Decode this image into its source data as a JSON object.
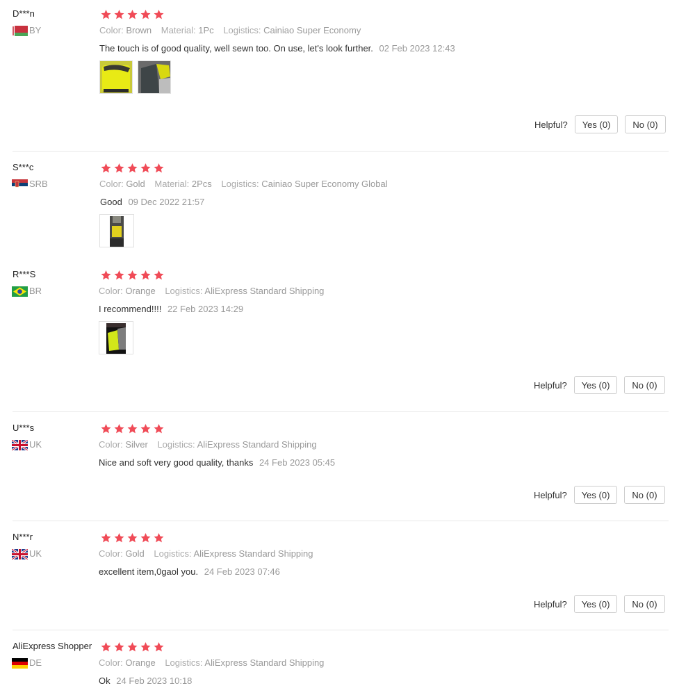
{
  "helpful_label": "Helpful?",
  "yes_label": "Yes (0)",
  "no_label": "No (0)",
  "star_color": "#f04b57",
  "reviews": [
    {
      "user": "D***n",
      "country": "BY",
      "rating": 5,
      "attributes": [
        {
          "key": "Color:",
          "value": "Brown"
        },
        {
          "key": "Material:",
          "value": "1Pc"
        },
        {
          "key": "Logistics:",
          "value": "Cainiao Super Economy"
        }
      ],
      "text": "The touch is of good quality, well sewn too. On use, let's look further.",
      "date": "02 Feb 2023 12:43",
      "photos": 2
    },
    {
      "user": "S***c",
      "country": "SRB",
      "rating": 5,
      "attributes": [
        {
          "key": "Color:",
          "value": "Gold"
        },
        {
          "key": "Material:",
          "value": "2Pcs"
        },
        {
          "key": "Logistics:",
          "value": "Cainiao Super Economy Global"
        }
      ],
      "text": "Good",
      "date": "09 Dec 2022 21:57",
      "photos": 1
    },
    {
      "user": "R***S",
      "country": "BR",
      "rating": 5,
      "attributes": [
        {
          "key": "Color:",
          "value": "Orange"
        },
        {
          "key": "Logistics:",
          "value": "AliExpress Standard Shipping"
        }
      ],
      "text": "I recommend!!!!",
      "date": "22 Feb 2023 14:29",
      "photos": 1
    },
    {
      "user": "U***s",
      "country": "UK",
      "rating": 5,
      "attributes": [
        {
          "key": "Color:",
          "value": "Silver"
        },
        {
          "key": "Logistics:",
          "value": "AliExpress Standard Shipping"
        }
      ],
      "text": "Nice and soft very good quality, thanks",
      "date": "24 Feb 2023 05:45",
      "photos": 0
    },
    {
      "user": "N***r",
      "country": "UK",
      "rating": 5,
      "attributes": [
        {
          "key": "Color:",
          "value": "Gold"
        },
        {
          "key": "Logistics:",
          "value": "AliExpress Standard Shipping"
        }
      ],
      "text": "excellent item,0gaol you.",
      "date": "24 Feb 2023 07:46",
      "photos": 0
    },
    {
      "user": "AliExpress Shopper",
      "country": "DE",
      "rating": 5,
      "attributes": [
        {
          "key": "Color:",
          "value": "Orange"
        },
        {
          "key": "Logistics:",
          "value": "AliExpress Standard Shipping"
        }
      ],
      "text": "Ok",
      "date": "24 Feb 2023 10:18",
      "photos": 0
    }
  ]
}
